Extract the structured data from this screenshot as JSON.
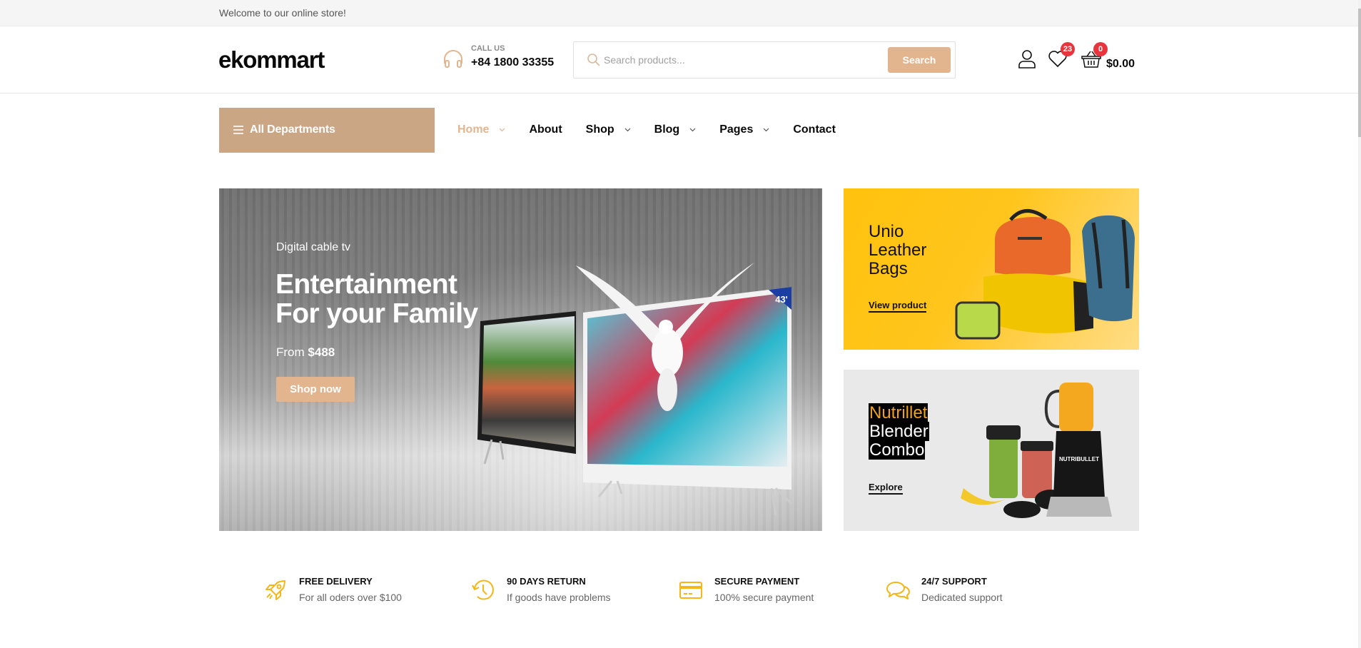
{
  "topbar": {
    "welcome": "Welcome to our online store!"
  },
  "header": {
    "logo": "ekommart",
    "call": {
      "label": "CALL US",
      "phone": "+84 1800 33355",
      "icon": "headphones-icon"
    },
    "search": {
      "placeholder": "Search products...",
      "value": "",
      "button": "Search",
      "icon": "search-icon"
    },
    "actions": {
      "account_icon": "user-icon",
      "wishlist_icon": "heart-icon",
      "wishlist_count": "23",
      "cart_icon": "basket-icon",
      "cart_count": "0",
      "cart_total": "$0.00"
    }
  },
  "nav": {
    "departments": "All Departments",
    "items": [
      {
        "label": "Home",
        "dropdown": true,
        "active": true
      },
      {
        "label": "About",
        "dropdown": false,
        "active": false
      },
      {
        "label": "Shop",
        "dropdown": true,
        "active": false
      },
      {
        "label": "Blog",
        "dropdown": true,
        "active": false
      },
      {
        "label": "Pages",
        "dropdown": true,
        "active": false
      },
      {
        "label": "Contact",
        "dropdown": false,
        "active": false
      }
    ]
  },
  "hero": {
    "eyebrow": "Digital cable tv",
    "title_line1": "Entertainment",
    "title_line2": "For your Family",
    "price_prefix": "From",
    "price": "$488",
    "button": "Shop now",
    "tv_badge": "43'"
  },
  "promos": [
    {
      "title_lines": [
        "Unio",
        "Leather",
        "Bags"
      ],
      "link": "View product"
    },
    {
      "title_lines": [
        "Nutrillet",
        "Blender",
        "Combo"
      ],
      "link": "Explore",
      "product_label": "NUTRIBULLET"
    }
  ],
  "features": [
    {
      "icon": "rocket-icon",
      "title": "FREE DELIVERY",
      "subtitle": "For all oders over $100"
    },
    {
      "icon": "history-icon",
      "title": "90 DAYS RETURN",
      "subtitle": "If goods have problems"
    },
    {
      "icon": "credit-card-icon",
      "title": "SECURE PAYMENT",
      "subtitle": "100% secure payment"
    },
    {
      "icon": "chat-icon",
      "title": "24/7 SUPPORT",
      "subtitle": "Dedicated support"
    }
  ],
  "colors": {
    "accent": "#e3b58f",
    "departments_bg": "#cba684",
    "badge": "#e8343c",
    "feature_icon": "#f4b619",
    "promo_yellow": "#ffc20d",
    "promo_grey": "#e9e9e9"
  }
}
